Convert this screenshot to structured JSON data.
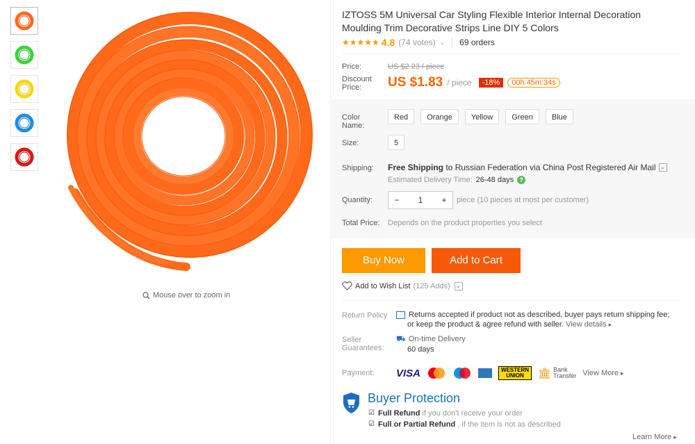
{
  "thumbnails": [
    {
      "name": "thumb-orange",
      "color": "#ff6a1a"
    },
    {
      "name": "thumb-green",
      "color": "#39d43a"
    },
    {
      "name": "thumb-yellow",
      "color": "#f5d80c"
    },
    {
      "name": "thumb-blue",
      "color": "#1c8ee6"
    },
    {
      "name": "thumb-red",
      "color": "#d81818"
    }
  ],
  "gallery": {
    "zoom_hint": "Mouse over to zoom in",
    "main_color": "#ff6a1a"
  },
  "product": {
    "title": "IZTOSS 5M Universal Car Styling Flexible Interior Internal Decoration Moulding Trim Decorative Strips Line DIY 5 Colors",
    "rating": "4.8",
    "votes": "(74 votes)",
    "orders": "69 orders"
  },
  "pricing": {
    "price_label": "Price:",
    "old_price": "US $2.23 / piece",
    "discount_label_1": "Discount",
    "discount_label_2": "Price:",
    "price": "US $1.83",
    "per": "/ piece",
    "discount": "-18%",
    "timer": "00h:45m:34s"
  },
  "options": {
    "color_label_1": "Color",
    "color_label_2": "Name:",
    "colors": [
      "Red",
      "Orange",
      "Yellow",
      "Green",
      "Blue"
    ],
    "size_label": "Size:",
    "size": "5"
  },
  "shipping": {
    "label": "Shipping:",
    "text_bold": "Free Shipping",
    "text_rest": " to Russian Federation via China Post Registered Air Mail",
    "est_label": "Estimated Delivery Time:",
    "est_value": "26-48 days"
  },
  "quantity": {
    "label": "Quantity:",
    "value": "1",
    "note": "piece (10 pieces at most per customer)",
    "minus": "−",
    "plus": "+"
  },
  "total": {
    "label": "Total Price:",
    "value": "Depends on the product properties you select"
  },
  "actions": {
    "buy": "Buy Now",
    "cart": "Add to Cart",
    "wishlist": "Add to Wish List",
    "wish_count": "(125 Adds)"
  },
  "return_policy": {
    "label": "Return Policy",
    "line1": "Returns accepted if product not as described, buyer pays return shipping fee;",
    "line2": "or keep the product & agree refund with seller.",
    "details": "View details"
  },
  "guarantees": {
    "label_1": "Seller",
    "label_2": "Guarantees:",
    "item": "On-time Delivery",
    "days": "60 days"
  },
  "payment": {
    "label": "Payment:",
    "visa": "VISA",
    "wu_1": "WESTERN",
    "wu_2": "UNION",
    "bank_1": "Bank",
    "bank_2": "Transfer",
    "more": "View More"
  },
  "protection": {
    "title": "Buyer Protection",
    "item1_bold": "Full Refund",
    "item1_rest": " if you don't receive your order",
    "item2_bold": "Full or Partial Refund",
    "item2_rest": " , if the item is not as described",
    "learn": "Learn More"
  },
  "colors": {
    "accent": "#f60",
    "buy": "#f90",
    "cart": "#f65a09",
    "discount": "#e62e04",
    "link_blue": "#1a6fc4"
  }
}
